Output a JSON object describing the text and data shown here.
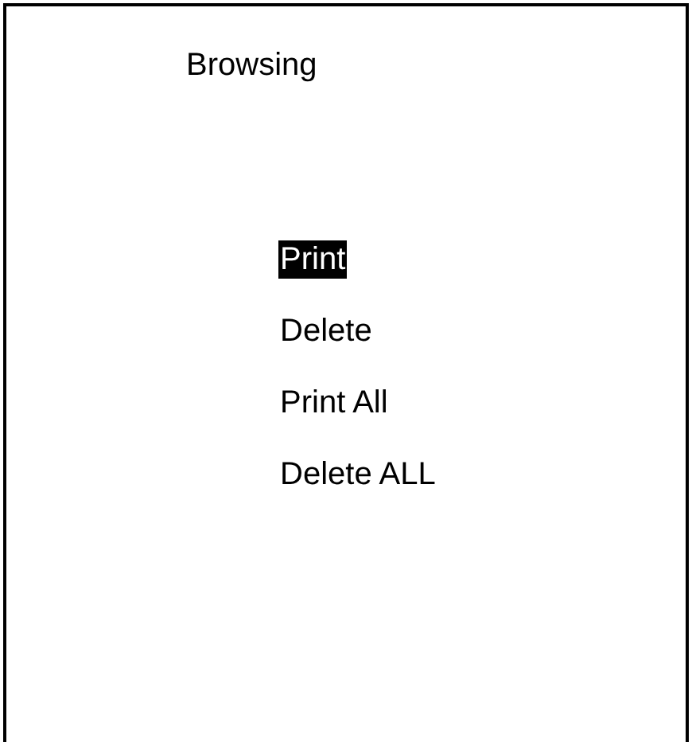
{
  "title": "Browsing",
  "menu": [
    {
      "label": "Print",
      "selected": true
    },
    {
      "label": "Delete",
      "selected": false
    },
    {
      "label": "Print All",
      "selected": false
    },
    {
      "label": "Delete ALL",
      "selected": false
    }
  ]
}
